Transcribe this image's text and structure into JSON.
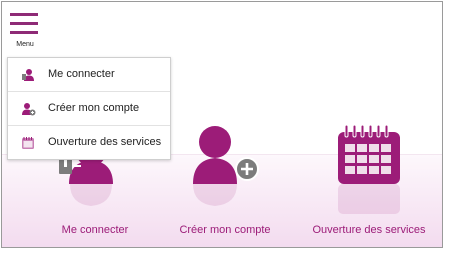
{
  "menu": {
    "label": "Menu"
  },
  "dropdown": {
    "items": [
      {
        "label": "Me connecter",
        "icon": "login-user-icon"
      },
      {
        "label": "Créer mon compte",
        "icon": "add-user-icon"
      },
      {
        "label": "Ouverture des services",
        "icon": "calendar-icon"
      }
    ]
  },
  "tiles": [
    {
      "label": "Me connecter",
      "icon": "login-user-icon"
    },
    {
      "label": "Créer mon compte",
      "icon": "add-user-icon"
    },
    {
      "label": "Ouverture des services",
      "icon": "calendar-icon"
    }
  ],
  "colors": {
    "accent": "#9c1c78",
    "menu": "#8e2a76",
    "plus_badge": "#7c7c7c",
    "band": "#f3dbef"
  }
}
